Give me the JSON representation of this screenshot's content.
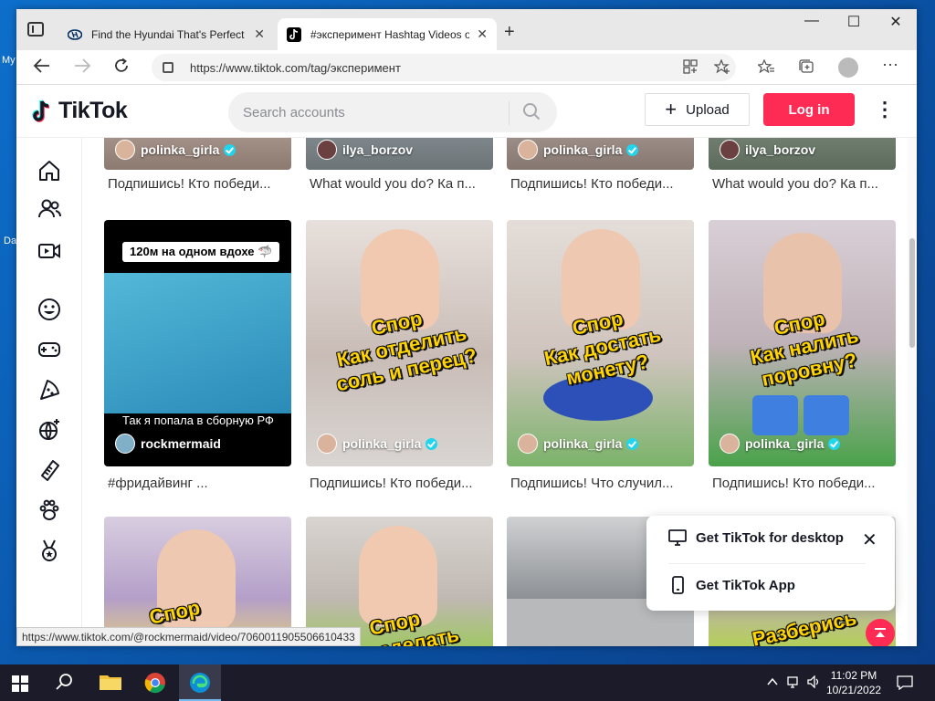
{
  "desktop": {
    "label_my": "My",
    "label_da": "Da"
  },
  "browser": {
    "tabs": [
      {
        "title": "Find the Hyundai That's Perfect F",
        "close": "✕"
      },
      {
        "title": "#эксперимент Hashtag Videos o",
        "close": "✕"
      }
    ],
    "new_tab": "+",
    "window_controls": {
      "minimize": "—",
      "maximize": "☐",
      "close": "✕"
    },
    "url": "https://www.tiktok.com/tag/эксперимент",
    "status_url": "https://www.tiktok.com/@rockmermaid/video/7060011905506610433"
  },
  "tiktok": {
    "logo": "TikTok",
    "search_placeholder": "Search accounts",
    "upload_label": "Upload",
    "login_label": "Log in",
    "more": "⋮",
    "accent": "#fe2c55",
    "top_row": [
      {
        "author": "polinka_girla",
        "verified": true,
        "caption": "Подпишись! Кто победи..."
      },
      {
        "author": "ilya_borzov",
        "verified": false,
        "caption": "What would you do? Ка п..."
      },
      {
        "author": "polinka_girla",
        "verified": true,
        "caption": "Подпишись! Кто победи..."
      },
      {
        "author": "ilya_borzov",
        "verified": false,
        "caption": "What would you do? Ка п..."
      }
    ],
    "mid_row": [
      {
        "author": "rockmermaid",
        "verified": false,
        "caption": "#фридайвинг ...",
        "overlay_top": "120м на одном вдохе 🦈",
        "overlay_bottom": "Так я попала в сборную РФ"
      },
      {
        "author": "polinka_girla",
        "verified": true,
        "caption": "Подпишись! Кто победи...",
        "overlay": "Спор\nКак отделить\nсоль и перец?"
      },
      {
        "author": "polinka_girla",
        "verified": true,
        "caption": "Подпишись! Что случил...",
        "overlay": "Спор\nКак достать\nмонету?"
      },
      {
        "author": "polinka_girla",
        "verified": true,
        "caption": "Подпишись! Кто победи...",
        "overlay": "Спор\nКак налить\nпоровну?"
      }
    ],
    "bottom_row": [
      {
        "overlay": "Спор\nКак"
      },
      {
        "overlay": "Спор\nКак сделать"
      },
      {
        "overlay": ""
      },
      {
        "overlay": "Разберись"
      }
    ],
    "popup": {
      "desktop_label": "Get TikTok for desktop",
      "app_label": "Get TikTok App",
      "close": "✕"
    }
  },
  "taskbar": {
    "time": "11:02 PM",
    "date": "10/21/2022"
  }
}
